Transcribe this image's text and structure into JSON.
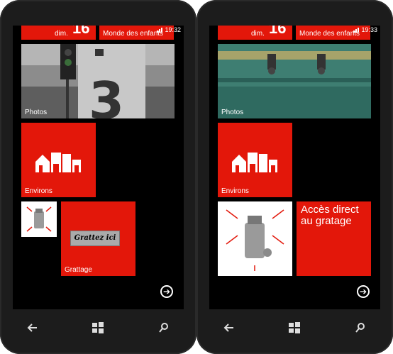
{
  "phones": [
    {
      "status": {
        "time": "19:32"
      },
      "top_tiles": {
        "day": "dim.",
        "date": "16",
        "monde": "Monde des enfants"
      },
      "photos_tile": {
        "label": "Photos"
      },
      "environs_tile": {
        "label": "Environs"
      },
      "grattage_tile": {
        "label": "Grattage",
        "scratch_text": "Grattez ici"
      }
    },
    {
      "status": {
        "time": "19:33"
      },
      "top_tiles": {
        "day": "dim.",
        "date": "16",
        "monde": "Monde des enfants"
      },
      "photos_tile": {
        "label": "Photos"
      },
      "environs_tile": {
        "label": "Environs"
      },
      "grattage_tile": {
        "label": "Accès direct au gratage"
      }
    }
  ],
  "colors": {
    "accent": "#e3170a",
    "background": "#000000"
  },
  "icons": [
    "back-icon",
    "windows-start-icon",
    "search-icon",
    "arrow-right-circle-icon",
    "buildings-icon"
  ]
}
